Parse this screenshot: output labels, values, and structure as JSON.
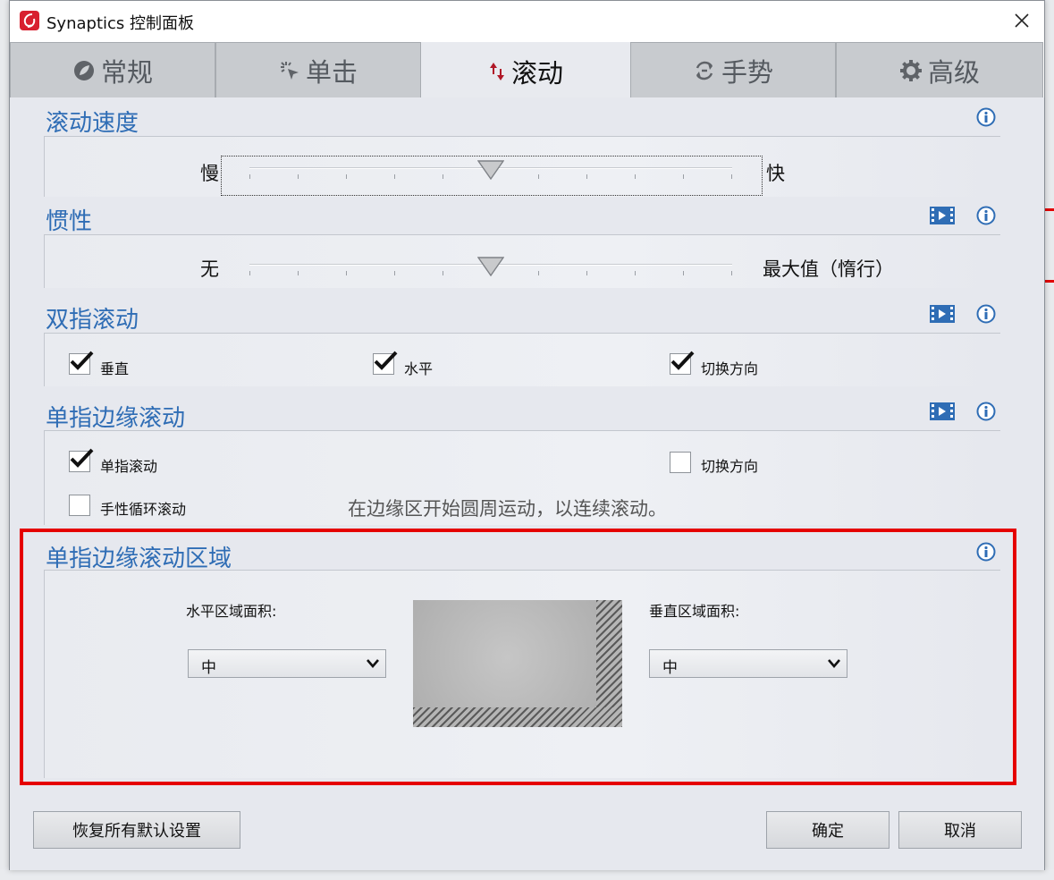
{
  "window": {
    "title": "Synaptics 控制面板",
    "app_icon": "synaptics-logo-icon",
    "close_icon": "close-icon"
  },
  "tabs": [
    {
      "label": "常规",
      "icon": "leaf-icon"
    },
    {
      "label": "单击",
      "icon": "click-icon"
    },
    {
      "label": "滚动",
      "icon": "scroll-arrows-icon",
      "active": true
    },
    {
      "label": "手势",
      "icon": "gesture-icon"
    },
    {
      "label": "高级",
      "icon": "gear-icon"
    }
  ],
  "scroll_speed": {
    "title": "滚动速度",
    "min_label": "慢",
    "max_label": "快",
    "level": 0.5
  },
  "inertia": {
    "title": "惯性",
    "min_label": "无",
    "max_label": "最大值（惰行）",
    "level": 0.5
  },
  "two_finger": {
    "title": "双指滚动",
    "options": [
      {
        "label": "垂直",
        "checked": true
      },
      {
        "label": "水平",
        "checked": true
      },
      {
        "label": "切换方向",
        "checked": true
      }
    ]
  },
  "edge_scroll": {
    "title": "单指边缘滚动",
    "single_finger": {
      "label": "单指滚动",
      "checked": true
    },
    "reverse": {
      "label": "切换方向",
      "checked": false
    },
    "chiral": {
      "label": "手性循环滚动",
      "checked": false
    },
    "hint": "在边缘区开始圆周运动，以连续滚动。"
  },
  "edge_area": {
    "title": "单指边缘滚动区域",
    "horizontal_label": "水平区域面积:",
    "horizontal_value": "中",
    "vertical_label": "垂直区域面积:",
    "vertical_value": "中"
  },
  "footer": {
    "restore_label": "恢复所有默认设置",
    "ok_label": "确定",
    "cancel_label": "取消"
  },
  "colors": {
    "section_title": "#2f6db5",
    "highlight": "#e50000",
    "brand": "#d8202f"
  }
}
